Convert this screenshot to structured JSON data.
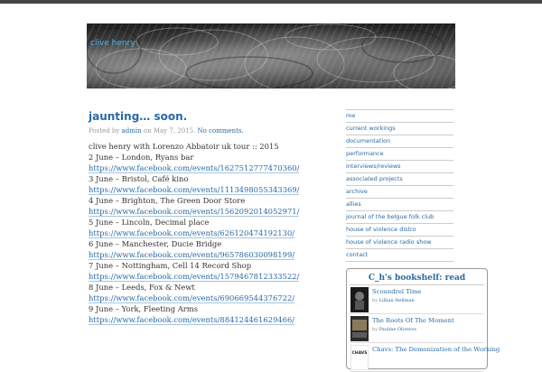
{
  "header": {
    "site_title": "clive henry"
  },
  "post": {
    "title": "jaunting… soon.",
    "meta": {
      "posted_by_label": "Posted by",
      "author": "admin",
      "on_label": "on",
      "date": "May 7, 2015.",
      "comments": "No comments."
    },
    "intro": "clive henry with Lorenzo Abbatoir uk tour :: 2015",
    "entries": [
      {
        "text": "2 June – London, Ryans bar ",
        "link": "https://www.facebook.com/events/1627512777470360/"
      },
      {
        "text": "3 June – Bristol, Café kino ",
        "link": "https://www.facebook.com/events/1113498055343369/"
      },
      {
        "text": "4 June – Brighton, The Green Door Store ",
        "link": "https://www.facebook.com/events/1562092014052971/"
      },
      {
        "text": "5 June – Lincoln, Decimal place ",
        "link": "https://www.facebook.com/events/626120474192130/"
      },
      {
        "text": "6 June – Manchester, Ducie Bridge ",
        "link": "https://www.facebook.com/events/965786030098199/"
      },
      {
        "text": "7 June – Nottingham, Cell 14 Record Shop ",
        "link": "https://www.facebook.com/events/1579467812333522/"
      },
      {
        "text": "8 June – Leeds, Fox & Newt ",
        "link": "https://www.facebook.com/events/690669544376722/"
      },
      {
        "text": "9 June – York, Fleeting Arms ",
        "link": "https://www.facebook.com/events/884124461629466/"
      }
    ]
  },
  "sidebar": {
    "nav": [
      "me",
      "current workings",
      "documentation",
      "performance",
      "interviews/reviews",
      "associated projects",
      "archive",
      "allies",
      "journal of the belgue folk club",
      "house of violence distro",
      "house of violence radio show",
      "contact"
    ],
    "bookshelf": {
      "title": "C_h's bookshelf: read",
      "by_label": "by",
      "books": [
        {
          "title": "Scoundrel Time",
          "author": "Lillian Hellman",
          "cover_color": "#1a1a1a"
        },
        {
          "title": "The Roots Of The Moment",
          "author": "Pauline Oliveros",
          "cover_color": "#3a3a3a"
        },
        {
          "title": "Chavs: The Demonization of the Working",
          "author": "",
          "cover_color": "#ffffff",
          "cover_text": "CHAVS"
        }
      ]
    }
  }
}
